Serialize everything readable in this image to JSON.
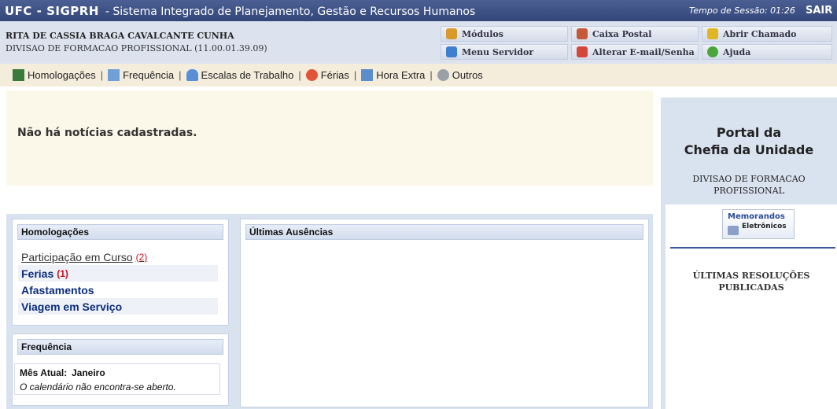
{
  "topbar": {
    "sys_code": "UFC - SIGPRH",
    "sys_name": "- Sistema Integrado de Planejamento, Gestão e Recursos Humanos",
    "session_label": "Tempo de Sessão: 01:26",
    "logout": "SAIR"
  },
  "user": {
    "name": "RITA DE CASSIA BRAGA CAVALCANTE CUNHA",
    "department": "DIVISAO DE FORMACAO PROFISSIONAL (11.00.01.39.09)"
  },
  "quick_links": {
    "modulos": "Módulos",
    "caixa_postal": "Caixa Postal",
    "abrir_chamado": "Abrir Chamado",
    "menu_servidor": "Menu Servidor",
    "alterar_email": "Alterar E-mail/Senha",
    "ajuda": "Ajuda"
  },
  "menu": {
    "homologacoes": "Homologações",
    "frequencia": "Frequência",
    "escalas": "Escalas de Trabalho",
    "ferias": "Férias",
    "hora_extra": "Hora Extra",
    "outros": "Outros",
    "separator": "|"
  },
  "news": {
    "message": "Não há notícias cadastradas."
  },
  "portal": {
    "title_line1": "Portal da",
    "title_line2": "Chefia da Unidade",
    "dept_line1": "DIVISAO DE FORMACAO",
    "dept_line2": "PROFISSIONAL",
    "memo_line1": "Memorandos",
    "memo_line2": "Eletrônicos",
    "resolucoes_line1": "ÚLTIMAS RESOLUÇÕES",
    "resolucoes_line2": "PUBLICADAS"
  },
  "homologacoes_panel": {
    "title": "Homologações",
    "items": [
      {
        "label": "Participação em Curso",
        "count": "(2)"
      },
      {
        "label": "Ferias",
        "count": "(1)"
      },
      {
        "label": "Afastamentos",
        "count": ""
      },
      {
        "label": "Viagem em Serviço",
        "count": ""
      }
    ]
  },
  "frequencia_panel": {
    "title": "Frequência",
    "mes_label": "Mês Atual:",
    "mes_value": "Janeiro",
    "note": "O calendário não encontra-se aberto."
  },
  "ausencias_panel": {
    "title": "Últimas Ausências"
  },
  "colors": {
    "topbar": "#324679",
    "infobar": "#dce3ef",
    "menubar": "#f4eddc",
    "news_bg": "#fbf7e9",
    "panel_bg": "#d9e2ef",
    "link": "#0b2d7a",
    "count": "#c0141c"
  }
}
